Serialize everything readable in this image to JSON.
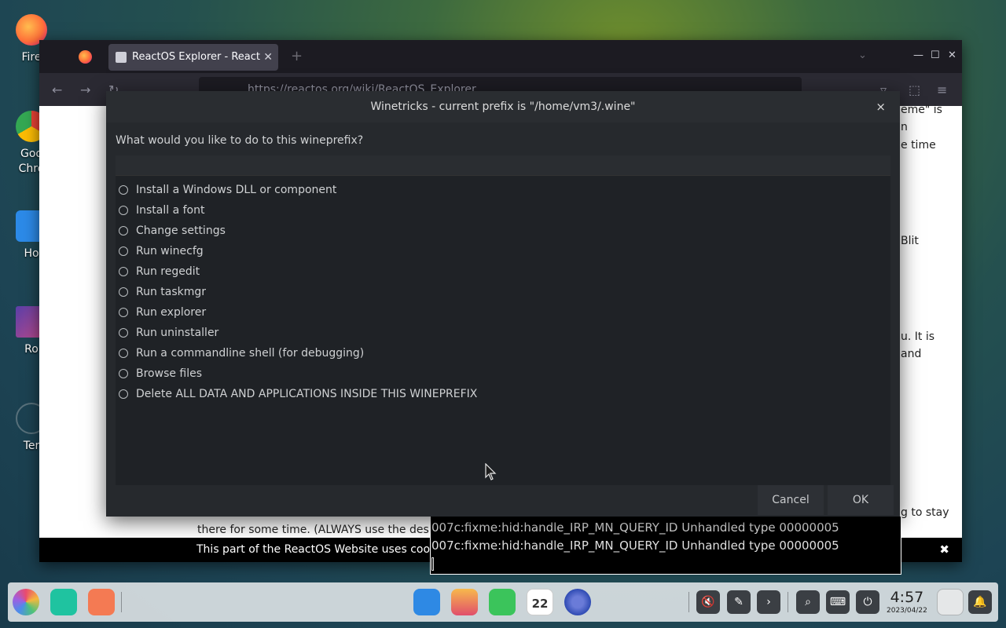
{
  "desktop": {
    "icons": [
      {
        "label": "Fire",
        "color": "#ff7139"
      },
      {
        "label": "Goo",
        "color": "#4285f4"
      },
      {
        "label": "Chro",
        "color": "#4285f4"
      },
      {
        "label": "Ho",
        "color": "#2c8ae8"
      },
      {
        "label": "Ro",
        "color": "#3b5ba5"
      },
      {
        "label": "Ter",
        "color": "#c7c7c7"
      }
    ]
  },
  "browser": {
    "tab_title": "ReactOS Explorer - React",
    "url": "https://reactos.org/wiki/ReactOS_Explorer",
    "page_snippets": {
      "s1": "eme\" is",
      "s2": "n",
      "s3": "e time",
      "s4": "Blit",
      "s5": "u. It is",
      "s6": "and",
      "s7": "g to stay",
      "s8": "there for some time. (ALWAYS use the design fo"
    },
    "cookie_text": "This part of the ReactOS Website uses cookies.",
    "cookie_close": "✖"
  },
  "terminal": {
    "lines": [
      "007c:fixme:hid:handle_IRP_MN_QUERY_ID Unhandled type 00000005",
      "007c:fixme:hid:handle_IRP_MN_QUERY_ID Unhandled type 00000005"
    ]
  },
  "dialog": {
    "title": "Winetricks - current prefix is \"/home/vm3/.wine\"",
    "close": "×",
    "prompt": "What would you like to do to this wineprefix?",
    "options": [
      "Install a Windows DLL or component",
      "Install a font",
      "Change settings",
      "Run winecfg",
      "Run regedit",
      "Run taskmgr",
      "Run explorer",
      "Run uninstaller",
      "Run a commandline shell (for debugging)",
      "Browse files",
      "Delete ALL DATA AND APPLICATIONS INSIDE THIS WINEPREFIX"
    ],
    "cancel_label": "Cancel",
    "ok_label": "OK"
  },
  "taskbar": {
    "clock_time": "4:57",
    "clock_date": "2023/04/22",
    "calendar_day": "22"
  }
}
